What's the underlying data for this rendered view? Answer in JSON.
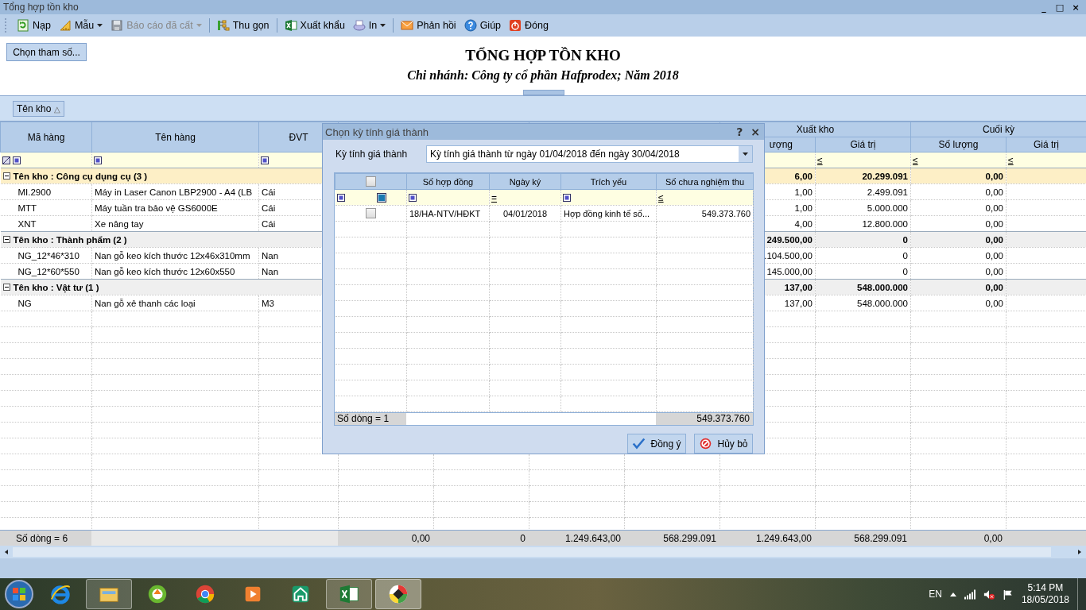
{
  "window": {
    "title": "Tổng hợp tồn kho",
    "controls": [
      "_",
      "□",
      "×"
    ]
  },
  "toolbar": [
    [
      {
        "label": "Nạp",
        "dropdown": false,
        "disabled": false
      },
      {
        "label": "Mẫu",
        "dropdown": true,
        "disabled": false
      },
      {
        "label": "Báo cáo đã cất",
        "dropdown": true,
        "disabled": true
      }
    ],
    [
      {
        "label": "Thu gọn",
        "dropdown": false,
        "disabled": false
      }
    ],
    [
      {
        "label": "Xuất khẩu",
        "dropdown": false,
        "disabled": false
      },
      {
        "label": "In",
        "dropdown": true,
        "disabled": false
      }
    ],
    [
      {
        "label": "Phản hồi",
        "dropdown": false,
        "disabled": false
      },
      {
        "label": "Giúp",
        "dropdown": false,
        "disabled": false
      },
      {
        "label": "Đóng",
        "dropdown": false,
        "disabled": false
      }
    ]
  ],
  "params_button": "Chọn tham số...",
  "report": {
    "title": "TỔNG HỢP TỒN KHO",
    "subtitle": "Chi nhánh: Công ty cổ phần Hafprodex; Năm 2018"
  },
  "group_panel": {
    "label": "Tên kho",
    "sort": "△"
  },
  "table": {
    "columns": [
      "Mã hàng",
      "Tên hàng",
      "ĐVT"
    ],
    "bands": [
      {
        "label": "Xuất kho",
        "columns": [
          "ượng",
          "Giá trị"
        ]
      },
      {
        "label": "Cuối kỳ",
        "columns": [
          "Số lượng",
          "Giá trị"
        ]
      }
    ],
    "filter_ops": [
      "≤",
      "≤",
      "≤"
    ],
    "groups": [
      {
        "label": "Tên kho : Công cụ dụng cụ (3 )",
        "selected": true,
        "expanded": true,
        "values": [
          "6,00",
          "20.299.091",
          "0,00"
        ],
        "rows": [
          {
            "code": "MI.2900",
            "name": "Máy in Laser Canon LBP2900 - A4 (LB",
            "unit": "Cái",
            "values": [
              "1,00",
              "2.499.091",
              "0,00"
            ]
          },
          {
            "code": "MTT",
            "name": "Máy tuần tra bảo vệ GS6000E",
            "unit": "Cái",
            "values": [
              "1,00",
              "5.000.000",
              "0,00"
            ]
          },
          {
            "code": "XNT",
            "name": "Xe nâng tay",
            "unit": "Cái",
            "values": [
              "4,00",
              "12.800.000",
              "0,00"
            ]
          }
        ]
      },
      {
        "label": "Tên kho : Thành phẩm (2 )",
        "selected": false,
        "expanded": true,
        "values": [
          "249.500,00",
          "0",
          "0,00"
        ],
        "rows": [
          {
            "code": "NG_12*46*310",
            "name": "Nan gỗ keo kích thước 12x46x310mm",
            "unit": "Nan",
            "values": [
              ".104.500,00",
              "0",
              "0,00"
            ]
          },
          {
            "code": "NG_12*60*550",
            "name": "Nan gỗ keo kích thước 12x60x550",
            "unit": "Nan",
            "values": [
              "145.000,00",
              "0",
              "0,00"
            ]
          }
        ]
      },
      {
        "label": "Tên kho : Vật tư (1 )",
        "selected": false,
        "expanded": true,
        "values": [
          "137,00",
          "548.000.000",
          "0,00"
        ],
        "rows": [
          {
            "code": "NG",
            "name": "Nan gỗ xẻ thanh các loại",
            "unit": "M3",
            "values": [
              "137,00",
              "548.000.000",
              "0,00"
            ]
          }
        ]
      }
    ],
    "footer": {
      "count": "Số dòng = 6",
      "totals": [
        "0,00",
        "0",
        "1.249.643,00",
        "568.299.091",
        "1.249.643,00",
        "568.299.091",
        "0,00"
      ]
    }
  },
  "dialog": {
    "title": "Chọn kỳ tính giá thành",
    "help": "?",
    "close": "×",
    "period_label": "Kỳ tính giá thành",
    "period_value": "Kỳ tính giá thành từ ngày 01/04/2018 đến ngày 30/04/2018",
    "grid": {
      "select_all": false,
      "columns": [
        "Số hợp đồng",
        "Ngày ký",
        "Trích yếu",
        "Số chưa nghiệm thu"
      ],
      "filter_ops": [
        "=",
        "≤"
      ],
      "rows": [
        {
          "checked": false,
          "contract": "18/HA-NTV/HĐKT",
          "date": "04/01/2018",
          "summary": "Hợp đồng kinh tế số...",
          "amount": "549.373.760"
        }
      ],
      "footer": {
        "count": "Số dòng = 1",
        "total": "549.373.760"
      }
    },
    "buttons": [
      "Đồng ý",
      "Hủy bỏ"
    ]
  },
  "taskbar": {
    "language": "EN",
    "time": "5:14 PM",
    "date": "18/05/2018"
  }
}
